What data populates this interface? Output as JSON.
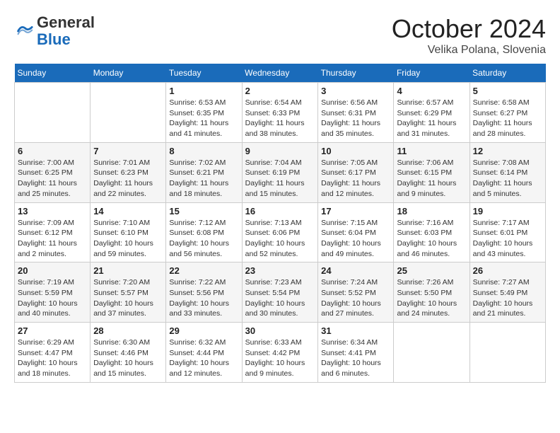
{
  "header": {
    "logo_general": "General",
    "logo_blue": "Blue",
    "month": "October 2024",
    "location": "Velika Polana, Slovenia"
  },
  "weekdays": [
    "Sunday",
    "Monday",
    "Tuesday",
    "Wednesday",
    "Thursday",
    "Friday",
    "Saturday"
  ],
  "weeks": [
    [
      {
        "day": "",
        "sunrise": "",
        "sunset": "",
        "daylight": ""
      },
      {
        "day": "",
        "sunrise": "",
        "sunset": "",
        "daylight": ""
      },
      {
        "day": "1",
        "sunrise": "Sunrise: 6:53 AM",
        "sunset": "Sunset: 6:35 PM",
        "daylight": "Daylight: 11 hours and 41 minutes."
      },
      {
        "day": "2",
        "sunrise": "Sunrise: 6:54 AM",
        "sunset": "Sunset: 6:33 PM",
        "daylight": "Daylight: 11 hours and 38 minutes."
      },
      {
        "day": "3",
        "sunrise": "Sunrise: 6:56 AM",
        "sunset": "Sunset: 6:31 PM",
        "daylight": "Daylight: 11 hours and 35 minutes."
      },
      {
        "day": "4",
        "sunrise": "Sunrise: 6:57 AM",
        "sunset": "Sunset: 6:29 PM",
        "daylight": "Daylight: 11 hours and 31 minutes."
      },
      {
        "day": "5",
        "sunrise": "Sunrise: 6:58 AM",
        "sunset": "Sunset: 6:27 PM",
        "daylight": "Daylight: 11 hours and 28 minutes."
      }
    ],
    [
      {
        "day": "6",
        "sunrise": "Sunrise: 7:00 AM",
        "sunset": "Sunset: 6:25 PM",
        "daylight": "Daylight: 11 hours and 25 minutes."
      },
      {
        "day": "7",
        "sunrise": "Sunrise: 7:01 AM",
        "sunset": "Sunset: 6:23 PM",
        "daylight": "Daylight: 11 hours and 22 minutes."
      },
      {
        "day": "8",
        "sunrise": "Sunrise: 7:02 AM",
        "sunset": "Sunset: 6:21 PM",
        "daylight": "Daylight: 11 hours and 18 minutes."
      },
      {
        "day": "9",
        "sunrise": "Sunrise: 7:04 AM",
        "sunset": "Sunset: 6:19 PM",
        "daylight": "Daylight: 11 hours and 15 minutes."
      },
      {
        "day": "10",
        "sunrise": "Sunrise: 7:05 AM",
        "sunset": "Sunset: 6:17 PM",
        "daylight": "Daylight: 11 hours and 12 minutes."
      },
      {
        "day": "11",
        "sunrise": "Sunrise: 7:06 AM",
        "sunset": "Sunset: 6:15 PM",
        "daylight": "Daylight: 11 hours and 9 minutes."
      },
      {
        "day": "12",
        "sunrise": "Sunrise: 7:08 AM",
        "sunset": "Sunset: 6:14 PM",
        "daylight": "Daylight: 11 hours and 5 minutes."
      }
    ],
    [
      {
        "day": "13",
        "sunrise": "Sunrise: 7:09 AM",
        "sunset": "Sunset: 6:12 PM",
        "daylight": "Daylight: 11 hours and 2 minutes."
      },
      {
        "day": "14",
        "sunrise": "Sunrise: 7:10 AM",
        "sunset": "Sunset: 6:10 PM",
        "daylight": "Daylight: 10 hours and 59 minutes."
      },
      {
        "day": "15",
        "sunrise": "Sunrise: 7:12 AM",
        "sunset": "Sunset: 6:08 PM",
        "daylight": "Daylight: 10 hours and 56 minutes."
      },
      {
        "day": "16",
        "sunrise": "Sunrise: 7:13 AM",
        "sunset": "Sunset: 6:06 PM",
        "daylight": "Daylight: 10 hours and 52 minutes."
      },
      {
        "day": "17",
        "sunrise": "Sunrise: 7:15 AM",
        "sunset": "Sunset: 6:04 PM",
        "daylight": "Daylight: 10 hours and 49 minutes."
      },
      {
        "day": "18",
        "sunrise": "Sunrise: 7:16 AM",
        "sunset": "Sunset: 6:03 PM",
        "daylight": "Daylight: 10 hours and 46 minutes."
      },
      {
        "day": "19",
        "sunrise": "Sunrise: 7:17 AM",
        "sunset": "Sunset: 6:01 PM",
        "daylight": "Daylight: 10 hours and 43 minutes."
      }
    ],
    [
      {
        "day": "20",
        "sunrise": "Sunrise: 7:19 AM",
        "sunset": "Sunset: 5:59 PM",
        "daylight": "Daylight: 10 hours and 40 minutes."
      },
      {
        "day": "21",
        "sunrise": "Sunrise: 7:20 AM",
        "sunset": "Sunset: 5:57 PM",
        "daylight": "Daylight: 10 hours and 37 minutes."
      },
      {
        "day": "22",
        "sunrise": "Sunrise: 7:22 AM",
        "sunset": "Sunset: 5:56 PM",
        "daylight": "Daylight: 10 hours and 33 minutes."
      },
      {
        "day": "23",
        "sunrise": "Sunrise: 7:23 AM",
        "sunset": "Sunset: 5:54 PM",
        "daylight": "Daylight: 10 hours and 30 minutes."
      },
      {
        "day": "24",
        "sunrise": "Sunrise: 7:24 AM",
        "sunset": "Sunset: 5:52 PM",
        "daylight": "Daylight: 10 hours and 27 minutes."
      },
      {
        "day": "25",
        "sunrise": "Sunrise: 7:26 AM",
        "sunset": "Sunset: 5:50 PM",
        "daylight": "Daylight: 10 hours and 24 minutes."
      },
      {
        "day": "26",
        "sunrise": "Sunrise: 7:27 AM",
        "sunset": "Sunset: 5:49 PM",
        "daylight": "Daylight: 10 hours and 21 minutes."
      }
    ],
    [
      {
        "day": "27",
        "sunrise": "Sunrise: 6:29 AM",
        "sunset": "Sunset: 4:47 PM",
        "daylight": "Daylight: 10 hours and 18 minutes."
      },
      {
        "day": "28",
        "sunrise": "Sunrise: 6:30 AM",
        "sunset": "Sunset: 4:46 PM",
        "daylight": "Daylight: 10 hours and 15 minutes."
      },
      {
        "day": "29",
        "sunrise": "Sunrise: 6:32 AM",
        "sunset": "Sunset: 4:44 PM",
        "daylight": "Daylight: 10 hours and 12 minutes."
      },
      {
        "day": "30",
        "sunrise": "Sunrise: 6:33 AM",
        "sunset": "Sunset: 4:42 PM",
        "daylight": "Daylight: 10 hours and 9 minutes."
      },
      {
        "day": "31",
        "sunrise": "Sunrise: 6:34 AM",
        "sunset": "Sunset: 4:41 PM",
        "daylight": "Daylight: 10 hours and 6 minutes."
      },
      {
        "day": "",
        "sunrise": "",
        "sunset": "",
        "daylight": ""
      },
      {
        "day": "",
        "sunrise": "",
        "sunset": "",
        "daylight": ""
      }
    ]
  ]
}
